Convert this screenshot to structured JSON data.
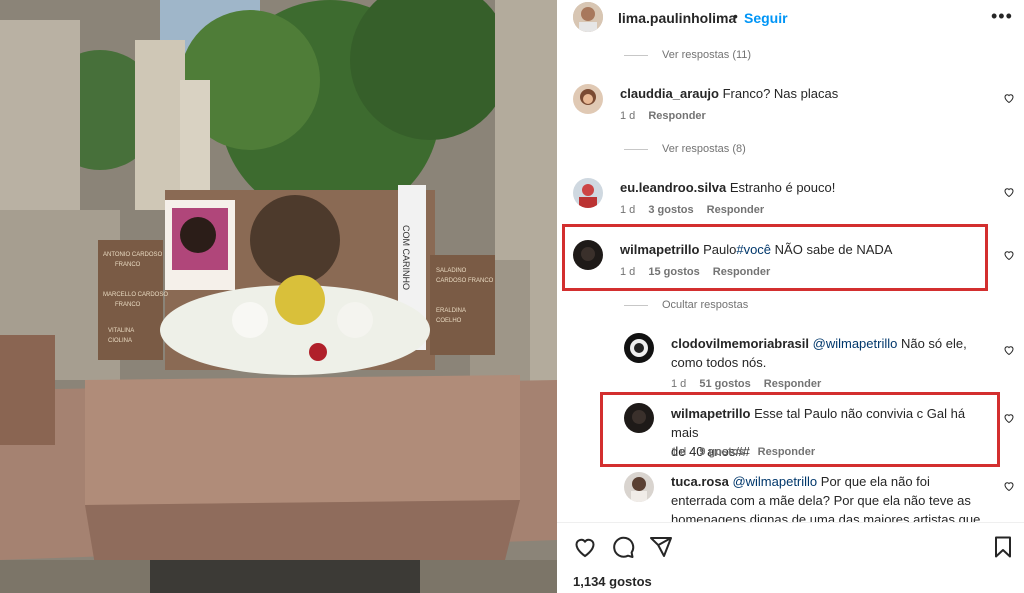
{
  "post": {
    "username": "lima.paulinholima",
    "dot": "•",
    "follow_label": "Seguir",
    "more_icon": "more-horizontal-icon",
    "likes_text": "1,134 gostos"
  },
  "photo": {
    "plaque_text": "COM CARINHO",
    "left_plaque": [
      "ANTONIO CARDOSO",
      "FRANCO",
      "MARCELLO CARDOSO",
      "FRANCO",
      "VITALINA",
      "CIOLINA"
    ],
    "right_plaque": [
      "SALADINO",
      "CARDOSO FRANCO",
      "ERALDINA",
      "COELHO"
    ]
  },
  "comments": {
    "view_replies_1": "Ver respostas (11)",
    "c1": {
      "user": "clauddia_araujo",
      "text": "Franco? Nas placas",
      "time": "1 d",
      "reply": "Responder"
    },
    "view_replies_2": "Ver respostas (8)",
    "c2": {
      "user": "eu.leandroo.silva",
      "text": "Estranho é pouco!",
      "time": "1 d",
      "likes": "3 gostos",
      "reply": "Responder"
    },
    "c3": {
      "user": "wilmapetrillo",
      "text_before": "Paulo",
      "hashtag": "#você",
      "text_after": " NÃO sabe de NADA",
      "time": "1 d",
      "likes": "15 gostos",
      "reply": "Responder"
    },
    "hide_replies": "Ocultar respostas",
    "r1": {
      "user": "clodovilmemoriabrasil",
      "mention": "@wilmapetrillo",
      "text_1": " Não só ele,",
      "text_2": "como todos nós.",
      "time": "1 d",
      "likes": "51 gostos",
      "reply": "Responder"
    },
    "r2": {
      "user": "wilmapetrillo",
      "text_1": " Esse tal Paulo não convivia c Gal há mais",
      "text_2": "de 40 anos##",
      "time": "1 d",
      "likes": "9 gostos",
      "reply": "Responder"
    },
    "r3": {
      "user": "tuca.rosa",
      "mention": "@wilmapetrillo",
      "text_1": " Por que ela não foi",
      "text_2": "enterrada com a mãe dela? Por que ela não teve as",
      "text_3": "homenagens dignas de uma das maiores artistas que"
    }
  },
  "icons": {
    "like": "heart-icon",
    "comment": "comment-icon",
    "share": "share-icon",
    "save": "bookmark-icon"
  },
  "colors": {
    "link_blue": "#0095f6",
    "mention": "#00376b",
    "highlight_red": "#d32f2f",
    "muted": "#737373"
  }
}
